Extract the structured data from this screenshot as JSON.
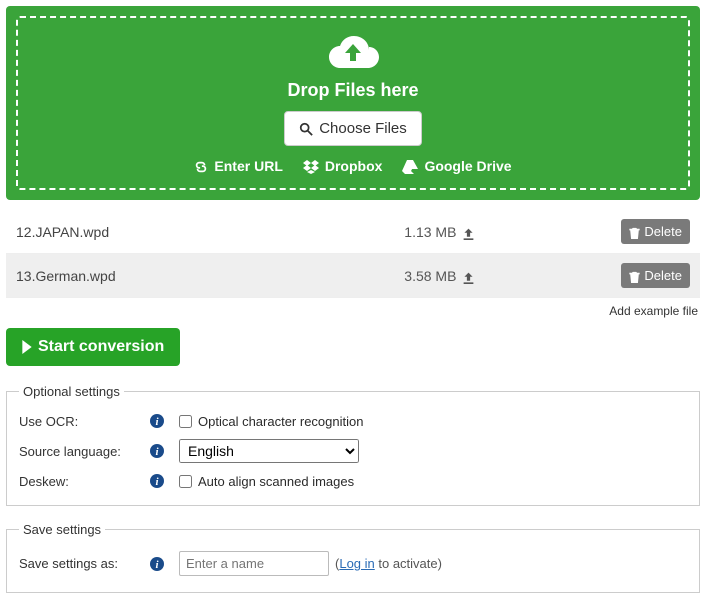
{
  "dropZone": {
    "title": "Drop Files here",
    "chooseLabel": "Choose Files",
    "sources": {
      "url": "Enter URL",
      "dropbox": "Dropbox",
      "gdrive": "Google Drive"
    }
  },
  "files": [
    {
      "name": "12.JAPAN.wpd",
      "size": "1.13 MB",
      "deleteLabel": "Delete"
    },
    {
      "name": "13.German.wpd",
      "size": "3.58 MB",
      "deleteLabel": "Delete"
    }
  ],
  "exampleLink": "Add example file",
  "startLabel": "Start conversion",
  "optional": {
    "legend": "Optional settings",
    "ocrLabel": "Use OCR:",
    "ocrText": "Optical character recognition",
    "langLabel": "Source language:",
    "langValue": "English",
    "deskewLabel": "Deskew:",
    "deskewText": "Auto align scanned images"
  },
  "saveSettings": {
    "legend": "Save settings",
    "label": "Save settings as:",
    "placeholder": "Enter a name",
    "loginText": "Log in",
    "activateText": " to activate)"
  }
}
